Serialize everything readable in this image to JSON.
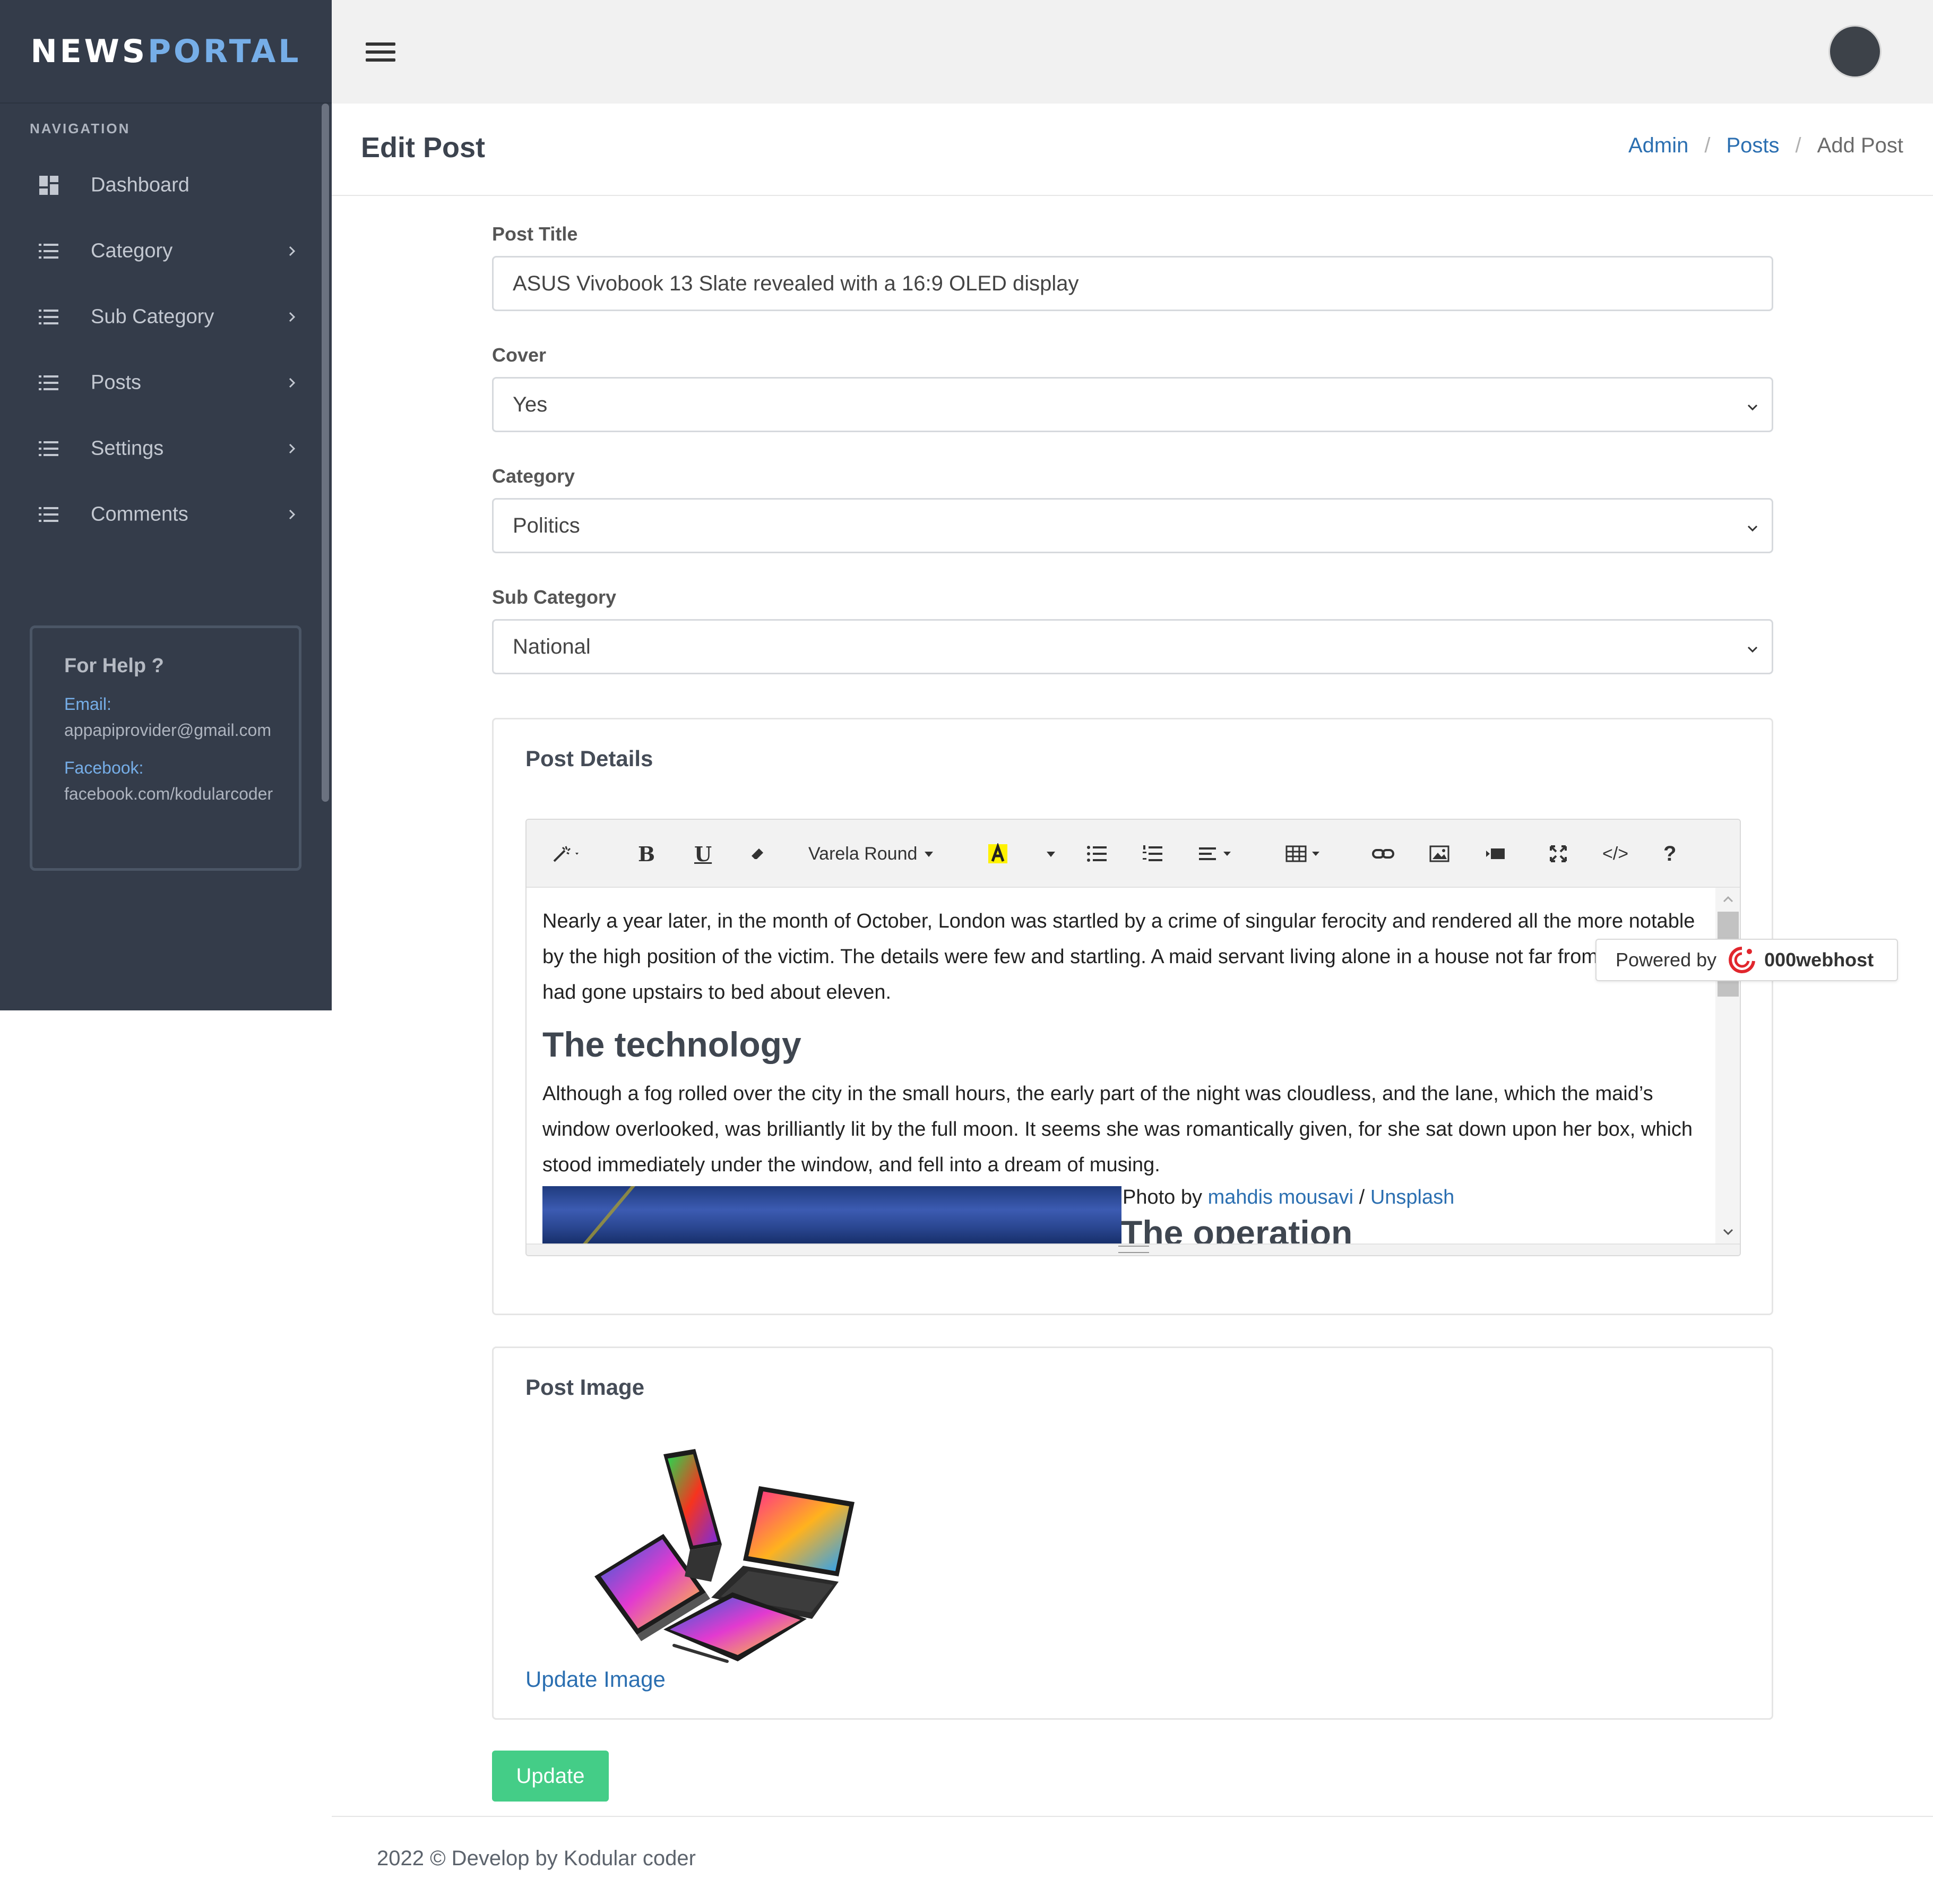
{
  "brand": {
    "part1": "NEWS",
    "part2": "PORTAL"
  },
  "sidebar": {
    "heading": "NAVIGATION",
    "items": [
      {
        "label": "Dashboard",
        "icon": "dashboard-icon",
        "has_children": false
      },
      {
        "label": "Category",
        "icon": "list-icon",
        "has_children": true
      },
      {
        "label": "Sub Category",
        "icon": "list-icon",
        "has_children": true
      },
      {
        "label": "Posts",
        "icon": "list-icon",
        "has_children": true
      },
      {
        "label": "Settings",
        "icon": "list-icon",
        "has_children": true
      },
      {
        "label": "Comments",
        "icon": "list-icon",
        "has_children": true
      }
    ],
    "help": {
      "title": "For Help ?",
      "email_label": "Email:",
      "email": "appapiprovider@gmail.com",
      "facebook_label": "Facebook:",
      "facebook": "facebook.com/kodularcoder"
    }
  },
  "header": {
    "title": "Edit Post",
    "breadcrumb": {
      "admin": "Admin",
      "posts": "Posts",
      "current": "Add Post",
      "separator": "/"
    }
  },
  "form": {
    "post_title_label": "Post Title",
    "post_title_value": "ASUS Vivobook 13 Slate revealed with a 16:9 OLED display",
    "cover_label": "Cover",
    "cover_value": "Yes",
    "category_label": "Category",
    "category_value": "Politics",
    "subcategory_label": "Sub Category",
    "subcategory_value": "National"
  },
  "post_details": {
    "title": "Post Details",
    "toolbar": {
      "font_name": "Varela Round",
      "help": "?",
      "code": "</>"
    },
    "paragraph1": "Nearly a year later, in the month of October, London was startled by a crime of singular ferocity and rendered all the more notable by the high position of the victim. The details were few and startling. A maid servant living alone in a house not far from the river, had gone upstairs to bed about eleven.",
    "heading1": "The technology",
    "paragraph2": "Although a fog rolled over the city in the small hours, the early part of the night was cloudless, and the lane, which the maid’s window overlooked, was brilliantly lit by the full moon. It seems she was romantically given, for she sat down upon her box, which stood immediately under the window, and fell into a dream of musing.",
    "photo_by": "Photo by ",
    "photographer": "mahdis mousavi",
    "credit_sep": " / ",
    "source": "Unsplash",
    "heading2_partial": "The operation"
  },
  "powered_by": {
    "label": "Powered by",
    "brand": "000webhost"
  },
  "post_image": {
    "title": "Post Image",
    "update_link": "Update Image"
  },
  "update_button": "Update",
  "footer": "2022 © Develop by Kodular coder",
  "colors": {
    "sidebar_bg": "#343c4a",
    "brand_accent": "#76aee8",
    "link": "#2b6fb1",
    "update_btn": "#44cd87"
  }
}
